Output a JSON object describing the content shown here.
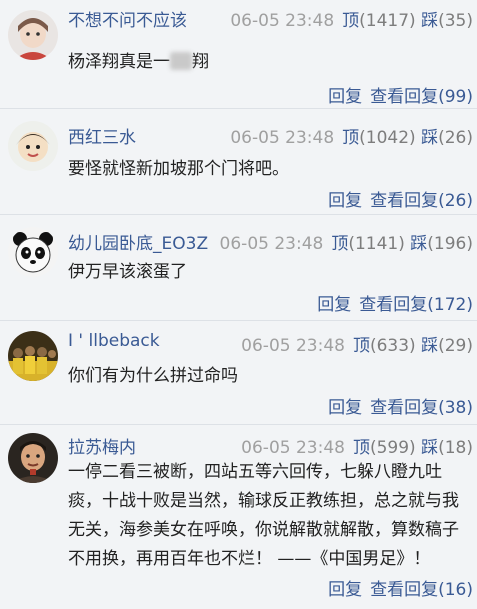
{
  "comments": [
    {
      "username": "不想不问不应该",
      "time": "06-05 23:48",
      "up_label": "顶",
      "up_count": "(1417)",
      "down_label": "踩",
      "down_count": "(35)",
      "text_pre": "杨泽翔真是一",
      "text_post": "翔",
      "reply_label": "回复",
      "view_replies": "查看回复(99)",
      "avatar": "baby-photo-avatar"
    },
    {
      "username": "西红三水",
      "time": "06-05 23:48",
      "up_label": "顶",
      "up_count": "(1042)",
      "down_label": "踩",
      "down_count": "(26)",
      "text": "要怪就怪新加坡那个门将吧。",
      "reply_label": "回复",
      "view_replies": "查看回复(26)",
      "avatar": "cartoon-avatar"
    },
    {
      "username": "幼儿园卧底_EO3Z",
      "time": "06-05 23:48",
      "up_label": "顶",
      "up_count": "(1141)",
      "down_label": "踩",
      "down_count": "(196)",
      "text": "伊万早该滚蛋了",
      "reply_label": "回复",
      "view_replies": "查看回复(172)",
      "avatar": "panda-avatar"
    },
    {
      "username": "I ' llbeback",
      "time": "06-05 23:48",
      "up_label": "顶",
      "up_count": "(633)",
      "down_label": "踩",
      "down_count": "(29)",
      "text": "你们有为什么拼过命吗",
      "reply_label": "回复",
      "view_replies": "查看回复(38)",
      "avatar": "team-photo-avatar"
    },
    {
      "username": "拉苏梅内",
      "time": "06-05 23:48",
      "up_label": "顶",
      "up_count": "(599)",
      "down_label": "踩",
      "down_count": "(18)",
      "text": "一停二看三被断，四站五等六回传，七躲八瞪九吐痰，十战十败是当然，输球反正教练担，总之就与我无关，海参美女在呼唤，你说解散就解散，算数稿子不用换，再用百年也不烂！ ——《中国男足》！",
      "reply_label": "回复",
      "view_replies": "查看回复(16)",
      "avatar": "portrait-avatar"
    }
  ]
}
